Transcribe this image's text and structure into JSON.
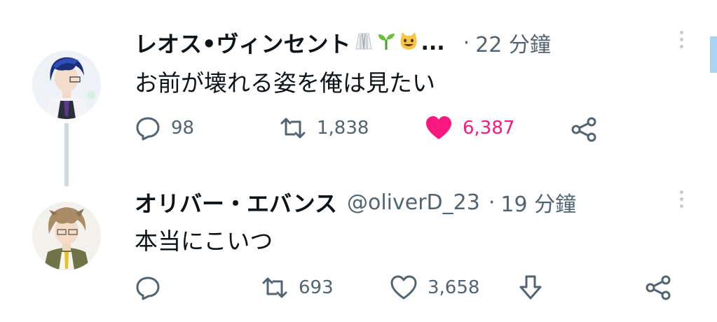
{
  "tweets": [
    {
      "display_name": "レオス•ヴィンセント",
      "badges": [
        "lab-coat-emoji",
        "seedling-emoji",
        "smiling-cat-emoji"
      ],
      "truncation": "...",
      "handle": "",
      "separator": "·",
      "timestamp": "22 分鐘",
      "text": "お前が壊れる姿を俺は見たい",
      "reply_count": "98",
      "retweet_count": "1,838",
      "like_count": "6,387",
      "liked": true
    },
    {
      "display_name": "オリバー・エバンス",
      "badges": [],
      "truncation": "",
      "handle": "@oliverD_23",
      "separator": "·",
      "timestamp": "19 分鐘",
      "text": "本当にこいつ",
      "reply_count": "",
      "retweet_count": "693",
      "like_count": "3,658",
      "liked": false
    }
  ],
  "colors": {
    "like_active": "#f91880",
    "secondary_text": "#536471",
    "primary_text": "#0f1419",
    "thread_line": "#cfd9de"
  }
}
